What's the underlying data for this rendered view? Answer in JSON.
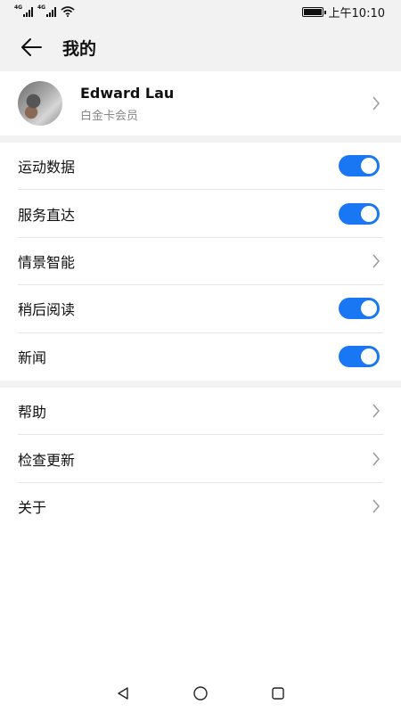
{
  "status": {
    "network_tag": "4G",
    "time": "上午10:10"
  },
  "header": {
    "title": "我的"
  },
  "profile": {
    "name": "Edward Lau",
    "membership": "白金卡会员"
  },
  "settings": [
    {
      "label": "运动数据",
      "control": "toggle",
      "on": true
    },
    {
      "label": "服务直达",
      "control": "toggle",
      "on": true
    },
    {
      "label": "情景智能",
      "control": "chevron"
    },
    {
      "label": "稍后阅读",
      "control": "toggle",
      "on": true
    },
    {
      "label": "新闻",
      "control": "toggle",
      "on": true
    }
  ],
  "more": [
    {
      "label": "帮助"
    },
    {
      "label": "检查更新"
    },
    {
      "label": "关于"
    }
  ],
  "colors": {
    "accent": "#1977f3",
    "background": "#f2f2f2"
  }
}
